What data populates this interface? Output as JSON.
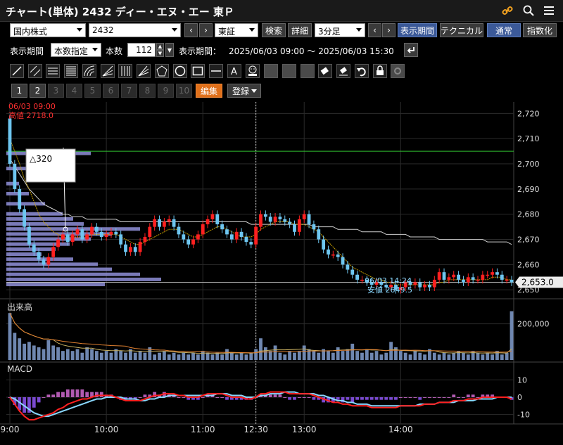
{
  "title": "チャート(単体) 2432 ディー・エヌ・エー 東Ｐ",
  "toolbar1": {
    "market_type": "国内株式",
    "code": "2432",
    "exchange": "東証",
    "search_label": "検索",
    "detail_label": "詳細",
    "interval": "3分足",
    "period_button": "表示期間",
    "technical_button": "テクニカル",
    "normal_button": "通常",
    "index_button": "指数化",
    "prev_arrow": "‹",
    "next_arrow": "›"
  },
  "toolbar2": {
    "period_label": "表示期間",
    "period_mode": "本数指定",
    "count_label": "本数",
    "count_value": "112",
    "range_label": "表示期間：",
    "range_value": "2025/06/03 09:00 ～ 2025/06/03 15:30"
  },
  "toolbar4": {
    "pages": [
      "1",
      "2",
      "3",
      "4",
      "5",
      "6",
      "7",
      "8",
      "9",
      "10"
    ],
    "edit_label": "編集",
    "register_label": "登録"
  },
  "icons": {
    "link": "link-icon",
    "search": "search-icon",
    "menu": "menu-icon",
    "tools": [
      "trendline-icon",
      "parallel-lines-icon",
      "horizontal-lines-icon",
      "fib-lines-icon",
      "arc-icon",
      "fan-icon",
      "vertical-lines-icon",
      "speed-lines-icon",
      "pentagon-icon",
      "circle-icon",
      "rectangle-icon",
      "hline-icon",
      "text-icon",
      "icon-stamp-icon",
      "copy-icon",
      "paste-icon",
      "move-icon",
      "eraser-icon",
      "erase-all-icon",
      "undo-icon",
      "lock-icon",
      "settings-icon"
    ]
  },
  "colors": {
    "up": "#ff2020",
    "down": "#6ec6f0",
    "volume": "#6f87b0",
    "ma_short": "#c8a000",
    "ma_long": "#d0d0d0",
    "macd": "#ff2020",
    "signal": "#8ad8ff",
    "green_line": "#30c030",
    "profile": "#8f8fd8"
  },
  "chart_data": {
    "type": "candlestick",
    "start_label": "06/03 09:00",
    "high_label": "高値 2718.0",
    "low_label_time": "06/03 14:24",
    "low_label": "安値 2649.5",
    "diff_label": "△320",
    "current_price_label": "2,653.0",
    "current_price": 2653,
    "green_line_price": 2705,
    "ylim": [
      2647,
      2724
    ],
    "y_ticks": [
      {
        "v": 2720,
        "t": "2,720"
      },
      {
        "v": 2710,
        "t": "2,710"
      },
      {
        "v": 2700,
        "t": "2,700"
      },
      {
        "v": 2690,
        "t": "2,690"
      },
      {
        "v": 2680,
        "t": "2,680"
      },
      {
        "v": 2670,
        "t": "2,670"
      },
      {
        "v": 2660,
        "t": "2,660"
      },
      {
        "v": 2650,
        "t": "2,650"
      }
    ],
    "x_ticks": [
      {
        "i": 0,
        "t": "9:00"
      },
      {
        "i": 20,
        "t": "10:00"
      },
      {
        "i": 40,
        "t": "11:00"
      },
      {
        "i": 51,
        "t": "12:30"
      },
      {
        "i": 61,
        "t": "13:00"
      },
      {
        "i": 81,
        "t": "14:00"
      }
    ],
    "vertical_line_index": 51,
    "closes": [
      2700,
      2690,
      2682,
      2675,
      2668,
      2665,
      2662,
      2660,
      2663,
      2667,
      2670,
      2672,
      2669,
      2672,
      2674,
      2670,
      2672,
      2675,
      2673,
      2671,
      2672,
      2673,
      2672,
      2668,
      2665,
      2667,
      2665,
      2669,
      2671,
      2675,
      2678,
      2675,
      2677,
      2678,
      2675,
      2672,
      2670,
      2668,
      2670,
      2672,
      2676,
      2678,
      2680,
      2676,
      2674,
      2672,
      2670,
      2673,
      2671,
      2669,
      2668,
      2675,
      2680,
      2679,
      2677,
      2679,
      2678,
      2677,
      2676,
      2673,
      2678,
      2680,
      2676,
      2674,
      2670,
      2666,
      2664,
      2664,
      2663,
      2660,
      2658,
      2656,
      2654,
      2654,
      2653,
      2652,
      2653,
      2652,
      2651,
      2652,
      2650,
      2651,
      2653,
      2652,
      2653,
      2651,
      2652,
      2651,
      2654,
      2657,
      2654,
      2655,
      2656,
      2654,
      2653,
      2655,
      2654,
      2654,
      2656,
      2656,
      2657,
      2656,
      2654,
      2654,
      2653
    ],
    "ma_short": [
      2710,
      2705,
      2700,
      2694,
      2690,
      2685,
      2680,
      2677,
      2675,
      2673,
      2672,
      2671,
      2671,
      2671,
      2671,
      2671,
      2671,
      2672,
      2672,
      2672,
      2672,
      2672,
      2672,
      2671,
      2670,
      2669,
      2668,
      2668,
      2669,
      2670,
      2671,
      2672,
      2673,
      2674,
      2674,
      2674,
      2673,
      2672,
      2671,
      2671,
      2672,
      2673,
      2674,
      2675,
      2675,
      2674,
      2673,
      2672,
      2671,
      2671,
      2671,
      2672,
      2674,
      2675,
      2676,
      2677,
      2677,
      2677,
      2677,
      2676,
      2676,
      2676,
      2675,
      2674,
      2673,
      2671,
      2669,
      2667,
      2665,
      2663,
      2661,
      2659,
      2658,
      2657,
      2656,
      2655,
      2654,
      2654,
      2653,
      2653,
      2652,
      2652,
      2652,
      2652,
      2652,
      2652,
      2652,
      2652,
      2652,
      2653,
      2653,
      2654,
      2654,
      2654,
      2654,
      2654,
      2654,
      2654,
      2654,
      2654,
      2655,
      2655,
      2655,
      2654,
      2654
    ],
    "ma_long": [
      2702,
      2699,
      2696,
      2693,
      2690,
      2688,
      2686,
      2684,
      2683,
      2682,
      2681,
      2680,
      2680,
      2679,
      2679,
      2679,
      2678,
      2678,
      2678,
      2678,
      2678,
      2678,
      2678,
      2677,
      2677,
      2677,
      2677,
      2677,
      2677,
      2677,
      2677,
      2677,
      2677,
      2677,
      2677,
      2677,
      2677,
      2677,
      2677,
      2677,
      2677,
      2677,
      2677,
      2677,
      2677,
      2677,
      2677,
      2677,
      2677,
      2677,
      2676,
      2676,
      2676,
      2676,
      2676,
      2676,
      2676,
      2676,
      2676,
      2676,
      2676,
      2676,
      2676,
      2675,
      2675,
      2675,
      2675,
      2675,
      2674,
      2674,
      2674,
      2674,
      2674,
      2673,
      2673,
      2673,
      2673,
      2673,
      2672,
      2672,
      2672,
      2672,
      2672,
      2671,
      2671,
      2671,
      2671,
      2671,
      2671,
      2670,
      2670,
      2670,
      2670,
      2670,
      2670,
      2670,
      2670,
      2670,
      2670,
      2669,
      2669,
      2669,
      2669,
      2669,
      2668
    ],
    "volume_label": "出来高",
    "volume_ticks": [
      {
        "v": 200000,
        "t": "200,000"
      }
    ],
    "volume_max": 300000,
    "volumes": [
      260000,
      150000,
      120000,
      90000,
      100000,
      80000,
      70000,
      60000,
      110000,
      80000,
      70000,
      50000,
      60000,
      50000,
      60000,
      40000,
      70000,
      60000,
      50000,
      40000,
      50000,
      40000,
      60000,
      50000,
      40000,
      60000,
      40000,
      50000,
      40000,
      70000,
      30000,
      40000,
      50000,
      30000,
      40000,
      30000,
      40000,
      30000,
      40000,
      30000,
      50000,
      40000,
      30000,
      40000,
      30000,
      60000,
      40000,
      30000,
      40000,
      30000,
      40000,
      60000,
      120000,
      70000,
      50000,
      80000,
      40000,
      30000,
      50000,
      40000,
      50000,
      80000,
      60000,
      50000,
      40000,
      60000,
      50000,
      40000,
      70000,
      50000,
      60000,
      90000,
      50000,
      40000,
      60000,
      40000,
      50000,
      30000,
      40000,
      100000,
      70000,
      50000,
      40000,
      30000,
      50000,
      40000,
      30000,
      60000,
      40000,
      30000,
      40000,
      30000,
      40000,
      50000,
      40000,
      30000,
      50000,
      40000,
      30000,
      40000,
      30000,
      50000,
      30000,
      40000,
      270000
    ],
    "macd_label": "MACD",
    "macd_ticks": [
      {
        "v": 10,
        "t": "10"
      },
      {
        "v": 0,
        "t": "0"
      },
      {
        "v": -10,
        "t": "-10"
      }
    ],
    "macd": [
      0,
      -4,
      -8,
      -11,
      -13,
      -13,
      -12,
      -11,
      -10,
      -9,
      -7,
      -6,
      -4,
      -3,
      -2,
      -1,
      -1,
      0,
      1,
      1,
      1,
      1,
      0,
      -1,
      -2,
      -2,
      -2,
      -2,
      -1,
      0,
      1,
      1,
      2,
      2,
      2,
      1,
      1,
      0,
      0,
      0,
      1,
      2,
      2,
      2,
      2,
      1,
      0,
      0,
      0,
      -1,
      -1,
      0,
      2,
      2,
      3,
      3,
      3,
      3,
      2,
      2,
      2,
      2,
      2,
      1,
      0,
      -1,
      -2,
      -3,
      -3,
      -4,
      -4,
      -5,
      -5,
      -5,
      -5,
      -6,
      -6,
      -6,
      -6,
      -6,
      -6,
      -5,
      -5,
      -5,
      -5,
      -5,
      -4,
      -4,
      -4,
      -3,
      -3,
      -3,
      -2,
      -2,
      -2,
      -1,
      -1,
      -1,
      0,
      0,
      0,
      0,
      0,
      0,
      -1
    ],
    "signal": [
      0,
      -1,
      -3,
      -5,
      -7,
      -9,
      -10,
      -11,
      -11,
      -10,
      -9,
      -8,
      -7,
      -6,
      -5,
      -4,
      -3,
      -2,
      -1,
      -1,
      0,
      0,
      0,
      0,
      -1,
      -1,
      -1,
      -2,
      -2,
      -1,
      -1,
      0,
      0,
      1,
      1,
      1,
      1,
      1,
      1,
      1,
      1,
      1,
      1,
      2,
      2,
      2,
      1,
      1,
      1,
      0,
      0,
      0,
      1,
      1,
      2,
      2,
      2,
      3,
      3,
      3,
      2,
      2,
      2,
      2,
      1,
      1,
      0,
      -1,
      -2,
      -2,
      -3,
      -3,
      -4,
      -4,
      -4,
      -5,
      -5,
      -5,
      -5,
      -5,
      -5,
      -5,
      -5,
      -5,
      -5,
      -4,
      -4,
      -4,
      -4,
      -3,
      -3,
      -3,
      -3,
      -2,
      -2,
      -2,
      -2,
      -1,
      -1,
      -1,
      -1,
      0,
      0,
      0,
      0
    ]
  }
}
